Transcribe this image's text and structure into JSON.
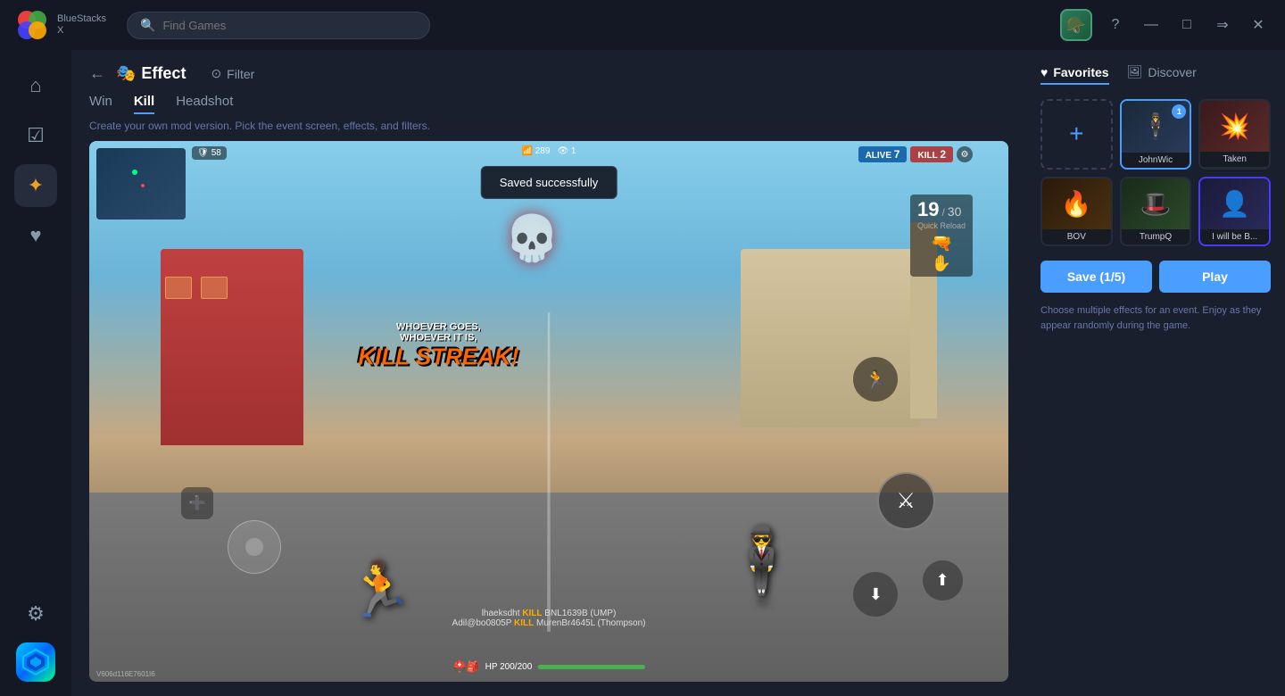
{
  "titlebar": {
    "brand": "BlueStacks X",
    "search_placeholder": "Find Games",
    "search_icon": "🔍"
  },
  "sidebar": {
    "items": [
      {
        "id": "home",
        "icon": "⌂",
        "label": "Home",
        "active": false
      },
      {
        "id": "library",
        "icon": "☑",
        "label": "Library",
        "active": false
      },
      {
        "id": "effects",
        "icon": "✦",
        "label": "Effects",
        "active": true
      },
      {
        "id": "favorites",
        "icon": "♥",
        "label": "Favorites",
        "active": false
      },
      {
        "id": "settings",
        "icon": "⚙",
        "label": "Settings",
        "active": false
      }
    ]
  },
  "header": {
    "back_label": "←",
    "effect_icon": "🎭",
    "effect_title": "Effect",
    "filter_icon": "⊙",
    "filter_label": "Filter"
  },
  "tabs": [
    {
      "id": "win",
      "label": "Win",
      "active": false
    },
    {
      "id": "kill",
      "label": "Kill",
      "active": true
    },
    {
      "id": "headshot",
      "label": "Headshot",
      "active": false
    }
  ],
  "subtitle": "Create your own mod version. Pick the event screen, effects, and filters.",
  "toast": {
    "message": "Saved successfully"
  },
  "game": {
    "minimap_label": "minimap",
    "hud_badge": "58",
    "wifi": "289",
    "eye": "1",
    "alive_label": "ALIVE",
    "alive_count": "7",
    "kill_label": "KILL",
    "kill_count": "2",
    "ammo_current": "19",
    "ammo_total": "30",
    "ammo_type": "Quick Reload",
    "kill_streak_line1": "WHOEVER GOES,",
    "kill_streak_line2": "WHOEVER IT IS,",
    "kill_streak_main": "KILL STREAK!",
    "kill_feed_1": "lhaeksdht KILL BNL1639B (UMP)",
    "kill_feed_2": "Adil@bo0805P KILL MurenBr4645L (Thompson)",
    "hp_text": "HP 200/200",
    "player_code": "V606d116E7601I6"
  },
  "right_panel": {
    "tabs": [
      {
        "id": "favorites",
        "icon": "♥",
        "label": "Favorites",
        "active": true
      },
      {
        "id": "discover",
        "icon": "🖼",
        "label": "Discover",
        "active": false
      }
    ],
    "cards": [
      {
        "id": "add",
        "type": "add"
      },
      {
        "id": "johnwick",
        "label": "JohnWic",
        "badge": "1",
        "selected": true,
        "bg": "#1a2a3a",
        "emoji": "🕴"
      },
      {
        "id": "taken",
        "label": "Taken",
        "badge": null,
        "selected": false,
        "bg": "#3a1a1a",
        "emoji": "💥"
      },
      {
        "id": "bov",
        "label": "BOV",
        "badge": null,
        "selected": false,
        "bg": "#2a1a0a",
        "emoji": "🔥"
      },
      {
        "id": "trumpq",
        "label": "TrumpQ",
        "badge": null,
        "selected": false,
        "bg": "#1a2a1a",
        "emoji": "🎩"
      },
      {
        "id": "iwillbe",
        "label": "I will be B...",
        "badge": null,
        "selected": false,
        "bg": "#1a1a3a",
        "emoji": "👤"
      }
    ],
    "save_btn": "Save (1/5)",
    "play_btn": "Play",
    "hint": "Choose multiple effects for an event. Enjoy as they appear randomly during the game."
  }
}
